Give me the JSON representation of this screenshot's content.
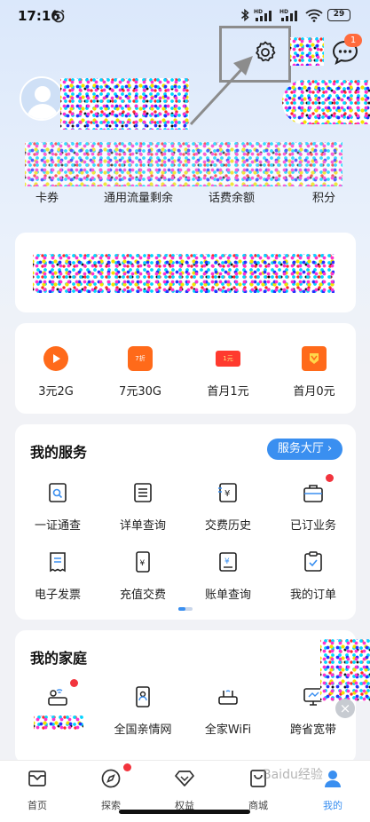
{
  "status_bar": {
    "time": "17:16",
    "battery": "29",
    "network_labels": [
      "HD",
      "HD"
    ]
  },
  "header": {
    "message_badge": "1",
    "icons": [
      "settings-icon",
      "message-icon"
    ]
  },
  "stats": {
    "labels": [
      "卡券",
      "通用流量剩余",
      "话费余额",
      "积分"
    ]
  },
  "promos": [
    {
      "label": "3元2G",
      "icon": "play-icon",
      "color": "#ff6a1a"
    },
    {
      "label": "7元30G",
      "icon": "tag-icon",
      "color": "#ff6a1a",
      "icon_text": "7折"
    },
    {
      "label": "首月1元",
      "icon": "coupon-icon",
      "color": "#ff3a2e",
      "icon_text": "1元"
    },
    {
      "label": "首月0元",
      "icon": "ribbon-icon",
      "color": "#ff6a1a"
    }
  ],
  "services": {
    "title": "我的服务",
    "hall_button": "服务大厅 ›",
    "items": [
      {
        "label": "一证通查",
        "icon": "id-search-icon"
      },
      {
        "label": "详单查询",
        "icon": "list-doc-icon"
      },
      {
        "label": "交费历史",
        "icon": "payment-history-icon"
      },
      {
        "label": "已订业务",
        "icon": "subscribed-bag-icon"
      },
      {
        "label": "电子发票",
        "icon": "invoice-icon"
      },
      {
        "label": "充值交费",
        "icon": "recharge-phone-icon"
      },
      {
        "label": "账单查询",
        "icon": "bill-icon"
      },
      {
        "label": "我的订单",
        "icon": "order-clipboard-icon"
      }
    ]
  },
  "family": {
    "title": "我的家庭",
    "items": [
      {
        "label": "全国亲情网",
        "icon": "family-phone-icon"
      },
      {
        "label": "全家WiFi",
        "icon": "router-icon"
      },
      {
        "label": "跨省宽带",
        "icon": "broadband-monitor-icon"
      }
    ]
  },
  "tabs": [
    {
      "label": "首页",
      "icon": "home-icon"
    },
    {
      "label": "探索",
      "icon": "compass-icon"
    },
    {
      "label": "权益",
      "icon": "diamond-icon"
    },
    {
      "label": "商城",
      "icon": "shopping-bag-icon"
    },
    {
      "label": "我的",
      "icon": "user-icon",
      "active": true
    }
  ],
  "watermark": "Baidu经验",
  "colors": {
    "accent": "#3a8ff0",
    "badge": "#ff6b3d",
    "red_dot": "#f2343d"
  }
}
